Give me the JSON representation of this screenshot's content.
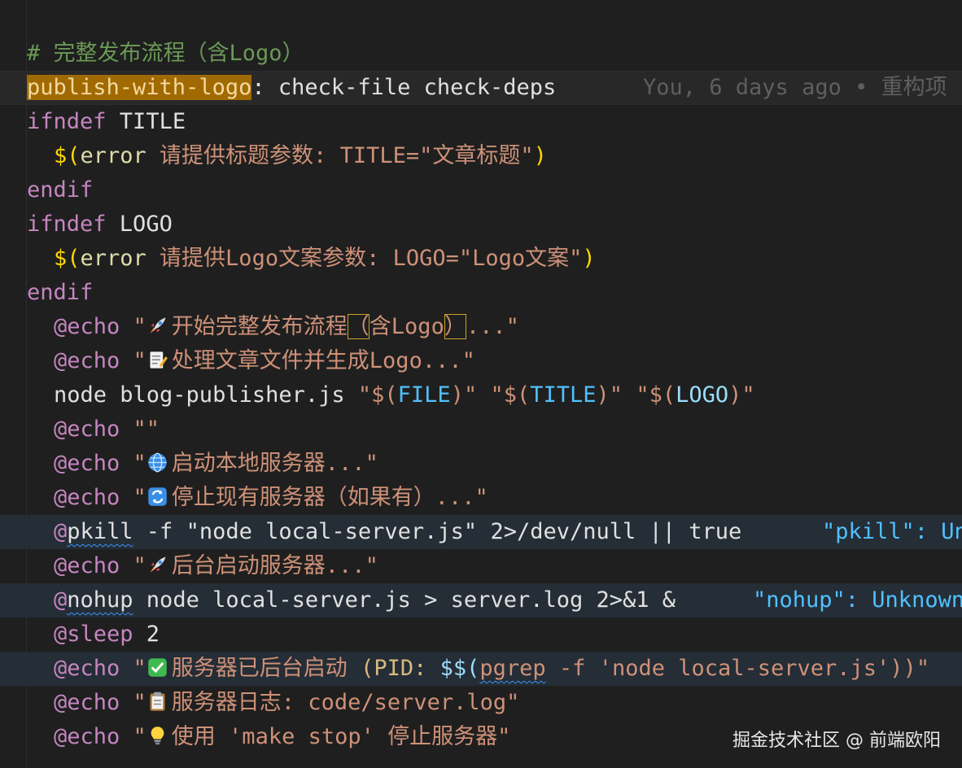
{
  "editor": {
    "comment": "# 完整发布流程（含Logo）",
    "target": {
      "name": "publish-with-logo",
      "colon": ":",
      "deps": " check-file check-deps",
      "blame": "You, 6 days ago • 重构项"
    },
    "ifndef_title": {
      "kw": "ifndef",
      "var": " TITLE"
    },
    "error_title": {
      "open": "$(",
      "fn": "error",
      "msg": " 请提供标题参数: TITLE=\"文章标题\"",
      "close": ")"
    },
    "endif1": "endif",
    "ifndef_logo": {
      "kw": "ifndef",
      "var": " LOGO"
    },
    "error_logo": {
      "open": "$(",
      "fn": "error",
      "msg": " 请提供Logo文案参数: LOGO=\"Logo文案\"",
      "close": ")"
    },
    "endif2": "endif",
    "echo1": {
      "at": "@echo",
      "q": " \"",
      "a": "开始完整发布流程",
      "p1": "（",
      "b": "含Logo",
      "p2": "）",
      "c": "...\""
    },
    "echo2": {
      "at": "@echo",
      "rest": " \"",
      "text": "处理文章文件并生成Logo...\""
    },
    "node_cmd": {
      "cmd": "node blog-publisher.js ",
      "q1": "\"$(",
      "v1": "FILE",
      "c1": ")\" ",
      "q2": "\"$(",
      "v2": "TITLE",
      "c2": ")\" ",
      "q3": "\"$(",
      "v3": "LOGO",
      "c3": ")\""
    },
    "echo_empty": {
      "at": "@echo",
      "rest": " \"\""
    },
    "echo3": {
      "at": "@echo",
      "rest": " \"",
      "text": "启动本地服务器...\""
    },
    "echo4": {
      "at": "@echo",
      "rest": " \"",
      "text": "停止现有服务器（如果有）...\""
    },
    "pkill": {
      "at": "@",
      "cmd": "pkill",
      "rest": " -f \"node local-server.js\" 2>/dev/null || true",
      "diag": "\"pkill\": Un"
    },
    "echo5": {
      "at": "@echo",
      "rest": " \"",
      "text": "后台启动服务器...\""
    },
    "nohup": {
      "at": "@",
      "cmd": "nohup",
      "rest": " node local-server.js > server.log 2>&1 &",
      "diag": "\"nohup\": Unknown"
    },
    "sleep": {
      "at": "@sleep",
      "rest": " 2"
    },
    "echo6": {
      "at": "@echo",
      "rest": " \"",
      "text": "服务器已后台启动 ",
      "pid": "(PID: ",
      "dollar": "$$(",
      "cmd": "pgrep",
      "tail": " -f 'node local-server.js'))\""
    },
    "echo7": {
      "at": "@echo",
      "rest": " \"",
      "text": "服务器日志: code/server.log\""
    },
    "echo8": {
      "at": "@echo",
      "rest": " \"",
      "text": "使用 'make stop' 停止服务器\""
    }
  },
  "icons": {
    "echo1": "rocket-icon",
    "echo2": "memo-icon",
    "echo3": "globe-icon",
    "echo4": "refresh-icon",
    "echo5": "rocket-icon",
    "echo6": "check-icon",
    "echo7": "clipboard-icon",
    "echo8": "lightbulb-icon"
  },
  "watermark": "掘金技术社区 @ 前端欧阳",
  "colors": {
    "background": "#1f1f1f",
    "keyword": "#c586c0",
    "string": "#ce9178",
    "variable": "#9cdcfe",
    "function": "#dcdcaa",
    "comment": "#6a9955",
    "target_highlight": "#a16a00"
  }
}
